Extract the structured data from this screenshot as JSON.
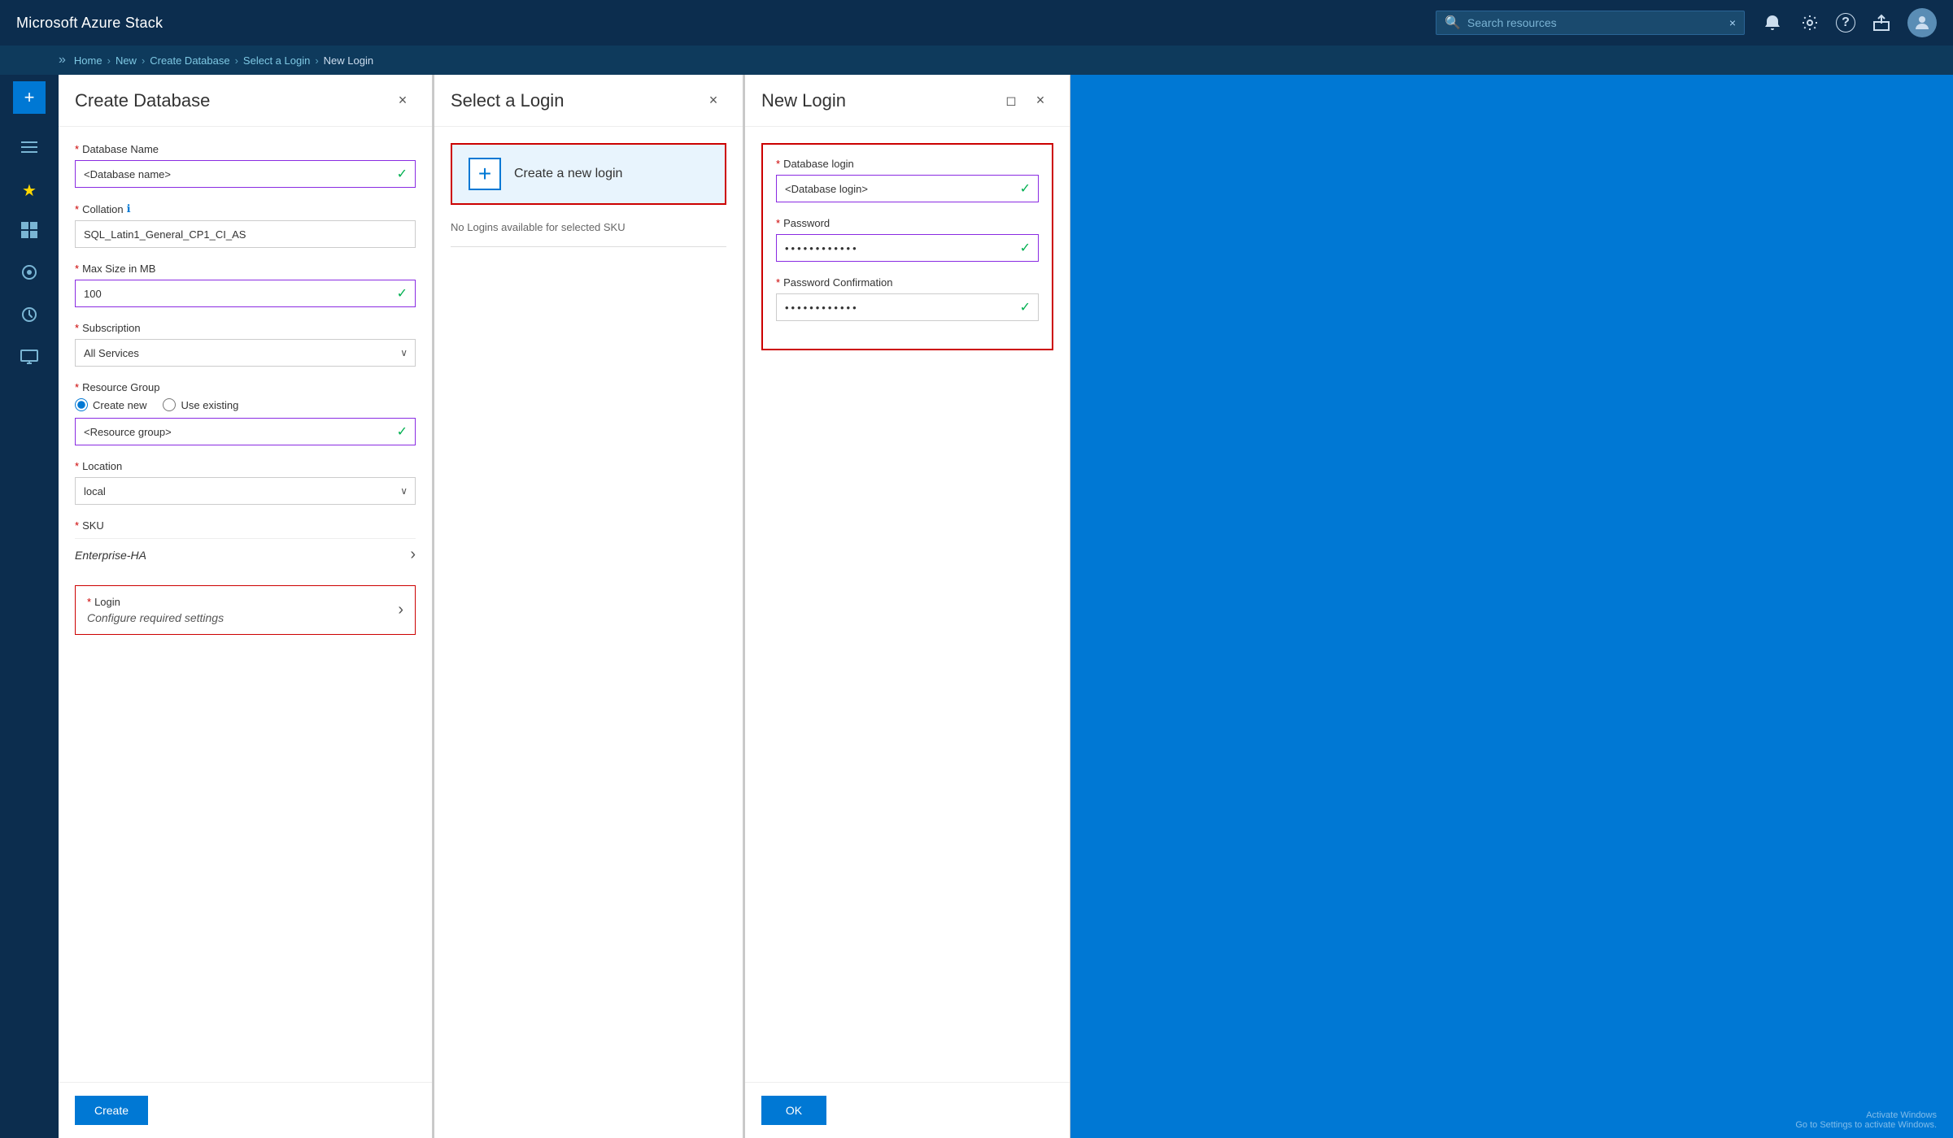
{
  "app": {
    "title": "Microsoft Azure Stack"
  },
  "topbar": {
    "title": "Microsoft Azure Stack",
    "search_placeholder": "Search resources",
    "close_label": "×"
  },
  "breadcrumb": {
    "items": [
      "Home",
      "New",
      "Create Database",
      "Select a Login",
      "New Login"
    ],
    "separators": [
      ">",
      ">",
      ">",
      ">"
    ]
  },
  "sidebar": {
    "add_label": "+",
    "items": [
      {
        "icon": "≡",
        "name": "menu-icon"
      },
      {
        "icon": "★",
        "name": "favorites-icon"
      },
      {
        "icon": "⊞",
        "name": "dashboard-icon"
      },
      {
        "icon": "◈",
        "name": "resources-icon"
      },
      {
        "icon": "◷",
        "name": "history-icon"
      },
      {
        "icon": "◔",
        "name": "monitor-icon"
      }
    ]
  },
  "panel1": {
    "title": "Create Database",
    "close_label": "×",
    "fields": {
      "database_name_label": "Database Name",
      "database_name_value": "<Database name>",
      "collation_label": "Collation",
      "collation_info": "ℹ",
      "collation_value": "SQL_Latin1_General_CP1_CI_AS",
      "max_size_label": "Max Size in MB",
      "max_size_value": "100",
      "subscription_label": "Subscription",
      "subscription_value": "All Services",
      "resource_group_label": "Resource Group",
      "create_new_label": "Create new",
      "use_existing_label": "Use existing",
      "resource_group_value": "<Resource group>",
      "location_label": "Location",
      "location_value": "local",
      "sku_label": "SKU",
      "sku_value": "Enterprise-HA",
      "login_label": "Login",
      "login_value": "Configure required settings"
    },
    "footer": {
      "create_btn": "Create"
    }
  },
  "panel2": {
    "title": "Select a Login",
    "close_label": "×",
    "create_new_login_label": "Create a new login",
    "no_logins_text": "No Logins available for selected SKU"
  },
  "panel3": {
    "title": "New Login",
    "close_label": "×",
    "maximize_label": "◻",
    "fields": {
      "db_login_label": "Database login",
      "db_login_value": "<Database login>",
      "password_label": "Password",
      "password_value": "••••••••••••",
      "password_confirm_label": "Password Confirmation",
      "password_confirm_value": "••••••••••••"
    },
    "footer": {
      "ok_btn": "OK"
    }
  },
  "watermark": {
    "line1": "Activate Windows",
    "line2": "Go to Settings to activate Windows."
  },
  "icons": {
    "search": "🔍",
    "bell": "🔔",
    "gear": "⚙",
    "question": "?",
    "export": "⬒",
    "check": "✓",
    "chevron_down": "∨",
    "chevron_right": "›",
    "plus": "+"
  }
}
